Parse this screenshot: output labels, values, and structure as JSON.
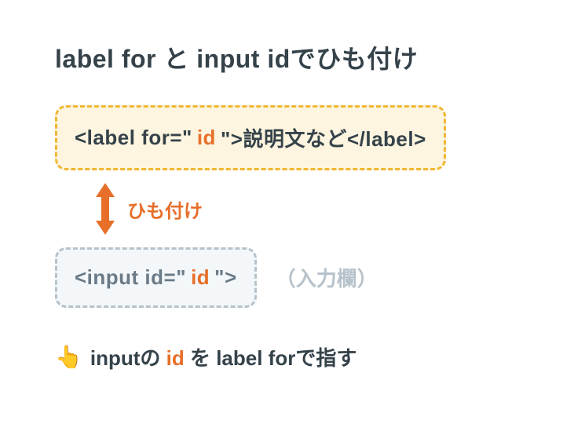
{
  "title": "label for と input idでひも付け",
  "label_box": {
    "open": "<label for=\"",
    "id": " id ",
    "mid": "\">説明文など</label>"
  },
  "link_text": "ひも付け",
  "input_box": {
    "open": "<input id=\"",
    "id": "id ",
    "close": "\">"
  },
  "input_hint": "（入力欄）",
  "footer": {
    "emoji": "👆",
    "t1": " inputの ",
    "id": "id",
    "t2": " を label forで指す"
  },
  "colors": {
    "accent": "#e76f2a",
    "label_border": "#f1b733",
    "label_bg": "#fdf5df",
    "input_border": "#b6c2cb",
    "input_bg": "#f3f7f9",
    "text": "#35424a"
  }
}
